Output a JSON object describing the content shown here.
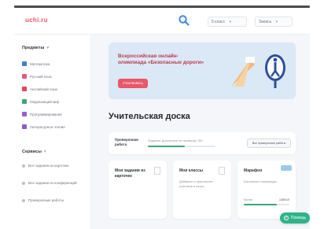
{
  "header": {
    "logo": "uchi.ru",
    "select_1": "5 класс",
    "select_2": "Запись",
    "chevron": "▾"
  },
  "sidebar": {
    "subjects_title": "Предметы",
    "subjects": [
      {
        "label": "Математика",
        "icon": "math-icon",
        "color": "#3f7fd9"
      },
      {
        "label": "Русский язык",
        "icon": "russian-icon",
        "color": "#e15b7a"
      },
      {
        "label": "Английский язык",
        "icon": "english-icon",
        "color": "#e0475b"
      },
      {
        "label": "Окружающий мир",
        "icon": "world-icon",
        "color": "#3aa776"
      },
      {
        "label": "Программирование",
        "icon": "code-icon",
        "color": "#9a5bd4"
      },
      {
        "label": "Литературное чтение",
        "icon": "reading-icon",
        "color": "#8a5cc7"
      }
    ],
    "services_title": "Сервисы",
    "services": [
      {
        "label": "Все задания из карточек"
      },
      {
        "label": "Все задания из конференций"
      },
      {
        "label": "Проверочные работы"
      }
    ]
  },
  "banner": {
    "text": "Всероссийская онлайн-олимпиада «Безопасные дороги»",
    "button": "Участвовать"
  },
  "page_title": "Учительская доска",
  "check": {
    "label": "Проверочная работа",
    "desc": "Задания, доступные на проверку: 0/0",
    "button": "Все проверочные работы",
    "progress": 0.55
  },
  "cards": [
    {
      "title": "Мои задания из карточек",
      "desc": ""
    },
    {
      "title": "Мои классы",
      "desc": "Добавьте и пригласите учеников в класс"
    },
    {
      "title": "Марафон",
      "desc": "Школьные олимпиады",
      "bar_label": "Баллы",
      "bar_value": "1380/10",
      "progress": 0.72
    }
  ],
  "help": {
    "label": "Помощь"
  },
  "colors": {
    "accent": "#e8576a",
    "green": "#2fb389",
    "banner_bg": "#dbe8f6"
  }
}
